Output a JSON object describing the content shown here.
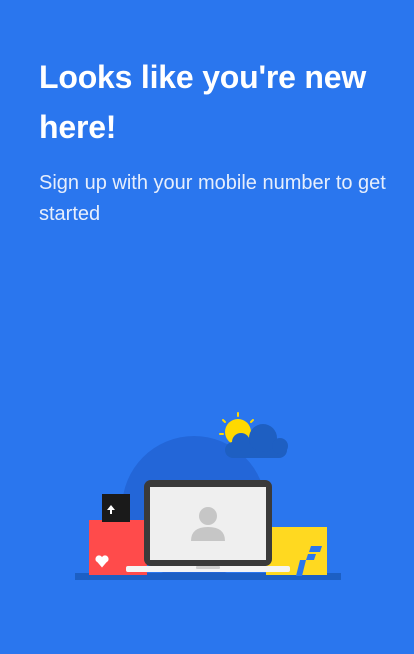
{
  "login_panel": {
    "heading": "Looks like you're new here!",
    "subtext": "Sign up with your mobile number to get started"
  },
  "illustration": {
    "brand_icon": "flipkart-f-icon",
    "colors": {
      "background": "#2a76ee",
      "circle": "#2366d8",
      "base": "#1c5fc4",
      "red_box": "#ff4b4b",
      "yellow_box": "#ffd920",
      "sun": "#ffd900",
      "cloud": "#1e5fc2",
      "laptop_frame": "#3a3a3a",
      "laptop_screen": "#efefef",
      "avatar": "#c6c6c6"
    }
  }
}
